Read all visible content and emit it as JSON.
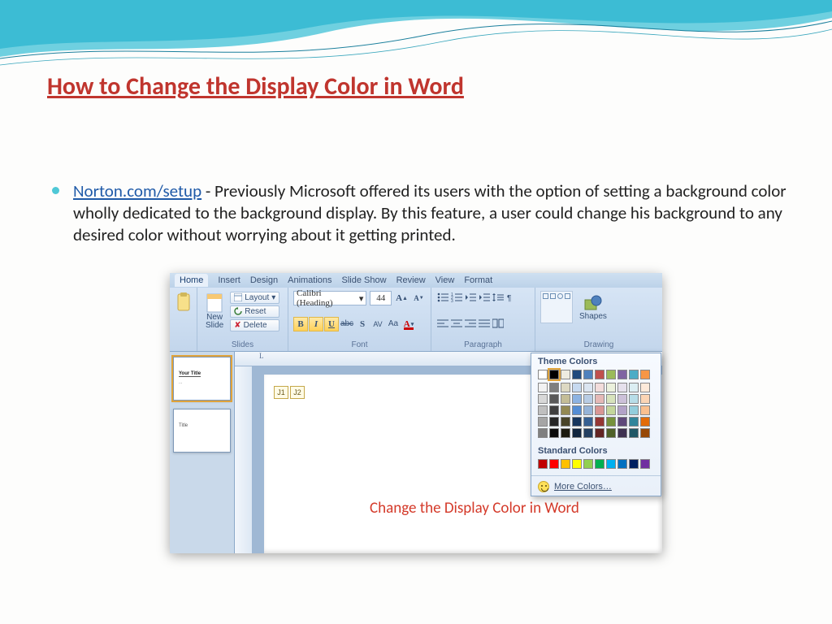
{
  "slide": {
    "title": "How to Change the Display Color in Word",
    "bullet": {
      "link_text": "Norton.com/setup",
      "body_text": " - Previously Microsoft offered its users with the option of setting a background color wholly dedicated to the background display. By this feature, a user could change his background to any desired color without worrying about it getting printed."
    }
  },
  "embedded": {
    "ribbon": {
      "tabs": [
        "Home",
        "Insert",
        "Design",
        "Animations",
        "Slide Show",
        "Review",
        "View",
        "Format"
      ],
      "active_tab": "Home",
      "slides_group": {
        "label": "Slides",
        "new_slide": "New\nSlide",
        "layout": "Layout",
        "reset": "Reset",
        "delete": "Delete"
      },
      "font_group": {
        "label": "Font",
        "font_name": "Calibri (Heading)",
        "font_size": "44",
        "buttons": {
          "bold": "B",
          "italic": "I",
          "underline": "U",
          "strike": "abc",
          "shadow": "S",
          "char_spacing": "AV",
          "case": "Aa",
          "font_color": "A"
        },
        "grow": "Aˆ",
        "shrink": "Aˇ"
      },
      "paragraph_group": {
        "label": "Paragraph"
      },
      "drawing_group": {
        "label": "Drawing",
        "shapes": "Shapes"
      }
    },
    "thumbs": {
      "slide1": {
        "title": "Your Title",
        "sub": "..."
      },
      "slide2": {
        "title": "Title"
      }
    },
    "canvas": {
      "marker1": "J1",
      "marker2": "J2",
      "caption": "Change the Display Color in Word"
    },
    "ruler_mark": "L"
  },
  "picker": {
    "theme_header": "Theme Colors",
    "standard_header": "Standard Colors",
    "more_colors": "More Colors…",
    "theme_head_row": [
      "#ffffff",
      "#000000",
      "#eeece1",
      "#1f497d",
      "#4f81bd",
      "#c0504d",
      "#9bbb59",
      "#8064a2",
      "#4bacc6",
      "#f79646"
    ],
    "theme_shades": [
      [
        "#f2f2f2",
        "#7f7f7f",
        "#ddd9c3",
        "#c6d9f0",
        "#dbe5f1",
        "#f2dcdb",
        "#ebf1dd",
        "#e5e0ec",
        "#dbeef3",
        "#fdeada"
      ],
      [
        "#d8d8d8",
        "#595959",
        "#c4bd97",
        "#8db3e2",
        "#b8cce4",
        "#e5b9b7",
        "#d7e3bc",
        "#ccc1d9",
        "#b7dde8",
        "#fbd5b5"
      ],
      [
        "#bfbfbf",
        "#3f3f3f",
        "#938953",
        "#548dd4",
        "#95b3d7",
        "#d99694",
        "#c3d69b",
        "#b2a2c7",
        "#92cddc",
        "#fac08f"
      ],
      [
        "#a5a5a5",
        "#262626",
        "#494429",
        "#17365d",
        "#366092",
        "#953734",
        "#76923c",
        "#5f497a",
        "#31859b",
        "#e36c09"
      ],
      [
        "#7f7f7f",
        "#0c0c0c",
        "#1d1b10",
        "#0f243e",
        "#244061",
        "#632423",
        "#4f6128",
        "#3f3151",
        "#205867",
        "#974806"
      ]
    ],
    "standard_row": [
      "#c00000",
      "#ff0000",
      "#ffc000",
      "#ffff00",
      "#92d050",
      "#00b050",
      "#00b0f0",
      "#0070c0",
      "#002060",
      "#7030a0"
    ]
  }
}
